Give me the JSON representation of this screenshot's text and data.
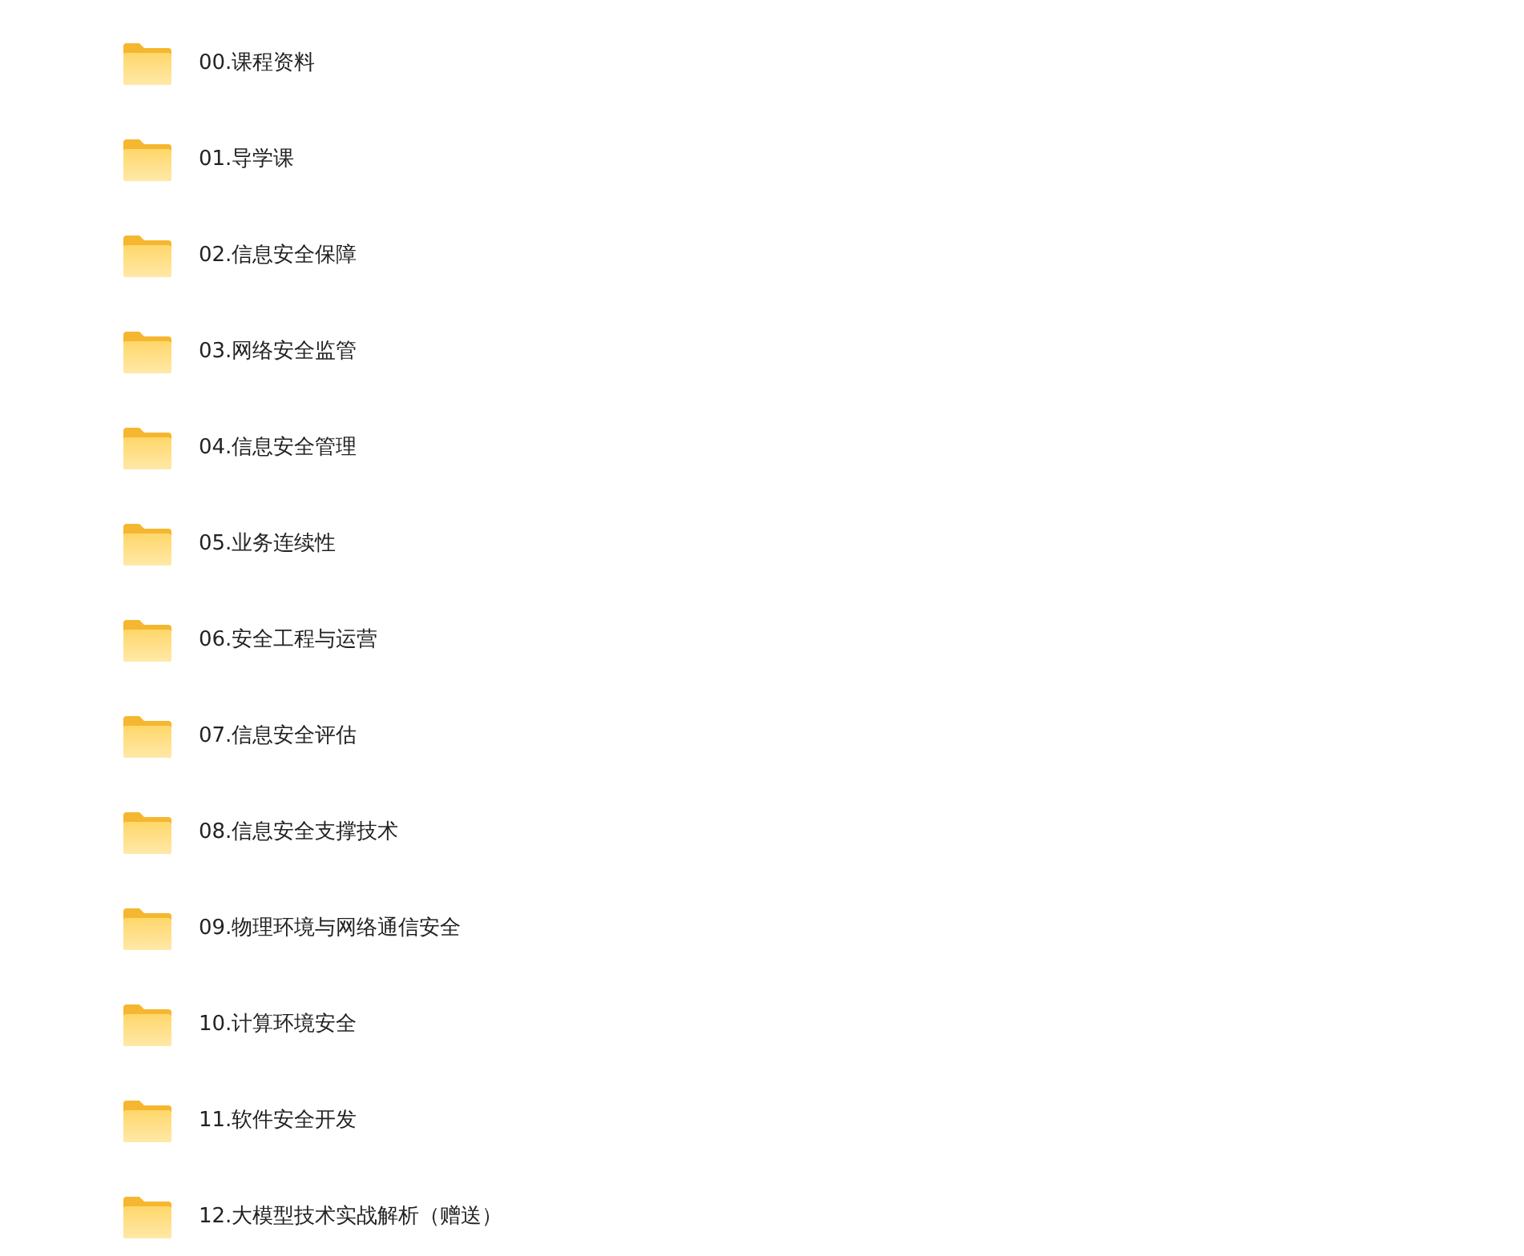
{
  "folders": [
    {
      "name": "00.课程资料"
    },
    {
      "name": "01.导学课"
    },
    {
      "name": "02.信息安全保障"
    },
    {
      "name": "03.网络安全监管"
    },
    {
      "name": "04.信息安全管理"
    },
    {
      "name": "05.业务连续性"
    },
    {
      "name": "06.安全工程与运营"
    },
    {
      "name": "07.信息安全评估"
    },
    {
      "name": "08.信息安全支撑技术"
    },
    {
      "name": "09.物理环境与网络通信安全"
    },
    {
      "name": "10.计算环境安全"
    },
    {
      "name": "11.软件安全开发"
    },
    {
      "name": "12.大模型技术实战解析（赠送）"
    }
  ]
}
